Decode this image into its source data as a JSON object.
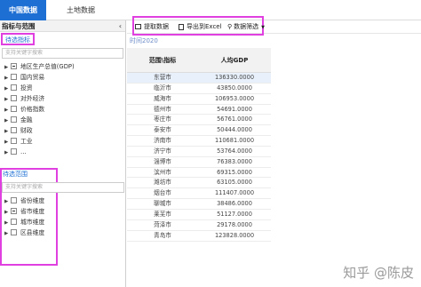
{
  "nav": {
    "tab_active": "中国数据",
    "tab_2": "土地数据"
  },
  "left": {
    "header": "指标与范围",
    "section1_title": "待选指标",
    "search1_placeholder": "支持关键字搜索",
    "indicators": [
      {
        "label": "地区生产总值(GDP)",
        "state": "partial"
      },
      {
        "label": "国内贸易",
        "state": "empty"
      },
      {
        "label": "投资",
        "state": "empty"
      },
      {
        "label": "对外经济",
        "state": "empty"
      },
      {
        "label": "价格指数",
        "state": "empty"
      },
      {
        "label": "金融",
        "state": "empty"
      },
      {
        "label": "财政",
        "state": "empty"
      },
      {
        "label": "工业",
        "state": "empty"
      },
      {
        "label": "…",
        "state": "empty"
      }
    ],
    "section2_title": "待选范围",
    "search2_placeholder": "支持关键字搜索",
    "ranges": [
      {
        "label": "省份维度",
        "state": "empty"
      },
      {
        "label": "省市维度",
        "state": "partial"
      },
      {
        "label": "城市维度",
        "state": "empty"
      },
      {
        "label": "区县维度",
        "state": "empty"
      }
    ]
  },
  "toolbar": {
    "fetch": "提取数据",
    "export": "导出到Excel",
    "filter": "数据筛选"
  },
  "time_label": "时间2020",
  "table": {
    "headers": [
      "范围\\指标",
      "人均GDP"
    ],
    "rows": [
      [
        "东营市",
        "136330.0000"
      ],
      [
        "临沂市",
        "43850.0000"
      ],
      [
        "威海市",
        "106953.0000"
      ],
      [
        "德州市",
        "54691.0000"
      ],
      [
        "枣庄市",
        "56761.0000"
      ],
      [
        "泰安市",
        "50444.0000"
      ],
      [
        "济南市",
        "110681.0000"
      ],
      [
        "济宁市",
        "53764.0000"
      ],
      [
        "淄博市",
        "76383.0000"
      ],
      [
        "滨州市",
        "69315.0000"
      ],
      [
        "潍坊市",
        "63105.0000"
      ],
      [
        "烟台市",
        "111407.0000"
      ],
      [
        "聊城市",
        "38486.0000"
      ],
      [
        "莱芜市",
        "51127.0000"
      ],
      [
        "菏泽市",
        "29178.0000"
      ],
      [
        "青岛市",
        "123828.0000"
      ]
    ]
  },
  "watermark": "知乎 @陈皮"
}
